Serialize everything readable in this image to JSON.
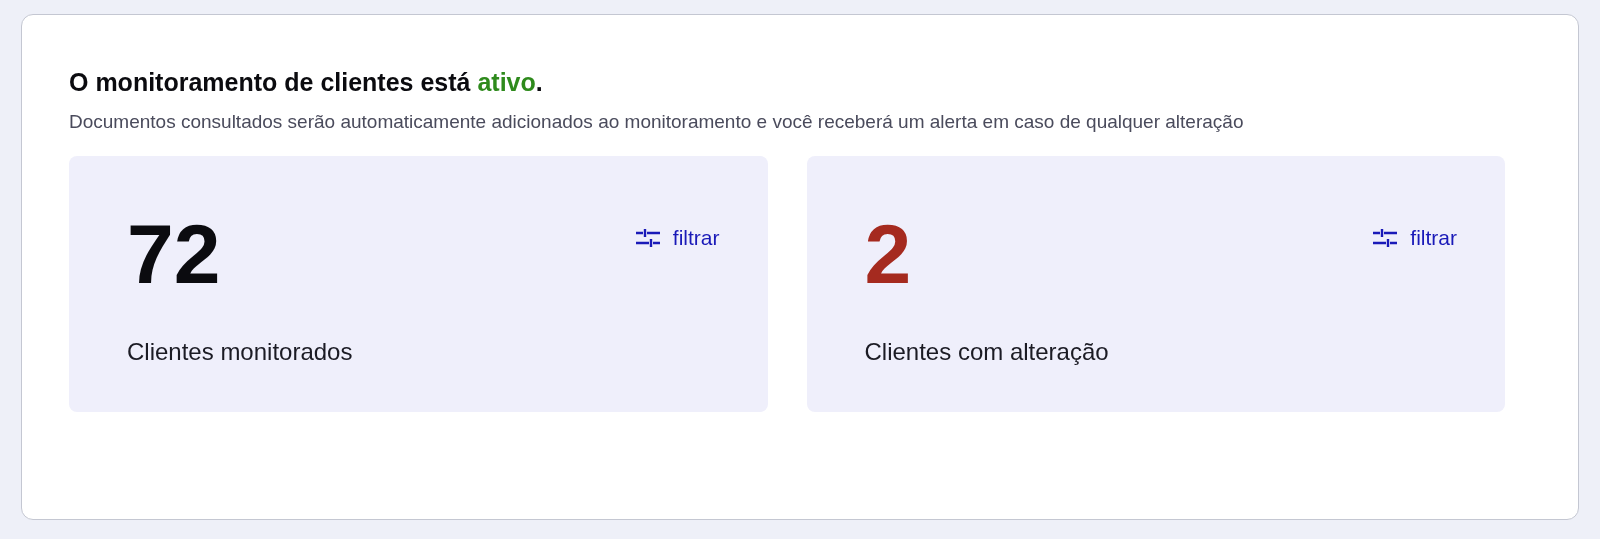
{
  "heading": {
    "before": "O monitoramento de clientes está ",
    "status": "ativo",
    "after": "."
  },
  "description": "Documentos consultados serão automaticamente adicionados ao monitoramento e você receberá um alerta em caso de qualquer alteração",
  "stats": [
    {
      "value": "72",
      "color": "#0b0b0f",
      "label": "Clientes monitorados",
      "action": "filtrar"
    },
    {
      "value": "2",
      "color": "#a52a1f",
      "label": "Clientes com alteração",
      "action": "filtrar"
    }
  ]
}
